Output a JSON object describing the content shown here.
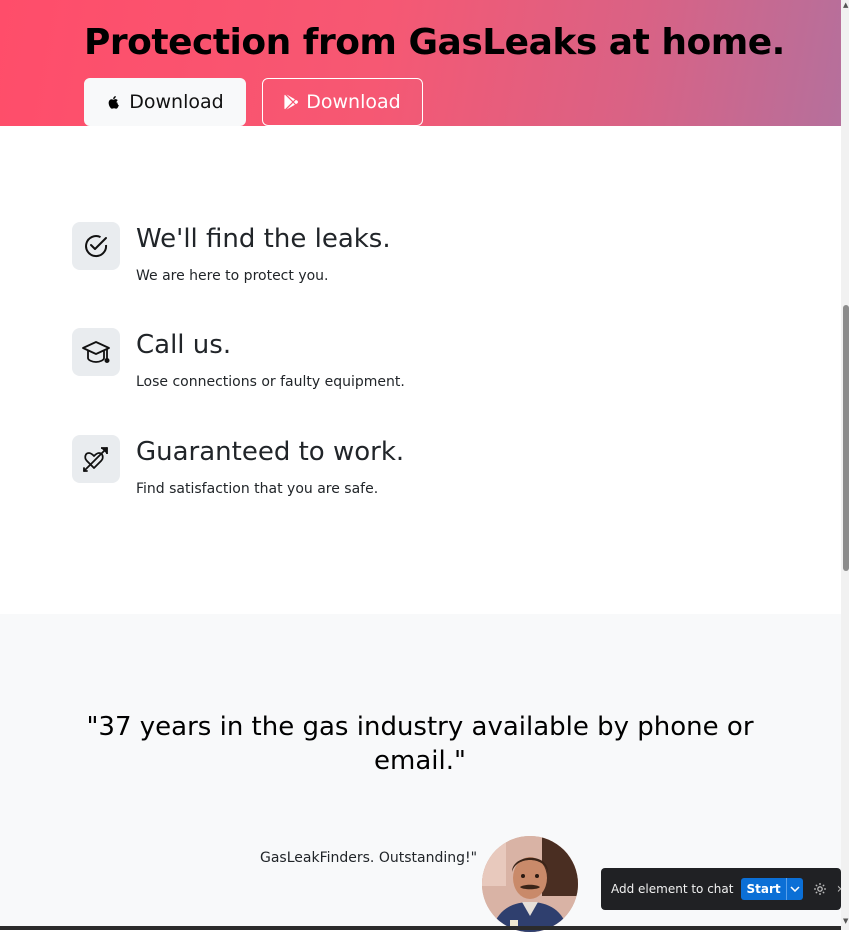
{
  "hero": {
    "title": "Protection from GasLeaks at home.",
    "apple_button_label": "Download",
    "play_button_label": "Download",
    "apple_icon": "apple-icon",
    "play_icon": "google-play-icon"
  },
  "features": [
    {
      "icon": "check-circle-icon",
      "title": "We'll find the leaks.",
      "text": "We are here to protect you."
    },
    {
      "icon": "graduation-cap-icon",
      "title": "Call us.",
      "text": "Lose connections or faulty equipment."
    },
    {
      "icon": "heart-arrow-icon",
      "title": "Guaranteed to work.",
      "text": "Find satisfaction that you are safe."
    }
  ],
  "testimonial": {
    "quote": "\"37 years in the gas industry available by phone or email.\"",
    "cite": "GasLeakFinders. Outstanding!\""
  },
  "chat_toolbar": {
    "label": "Add element to chat",
    "start_label": "Start"
  },
  "colors": {
    "hero_gradient_start": "#ff4d6a",
    "hero_gradient_end": "#b5709c",
    "testimonial_bg": "#f8f9fa",
    "chat_start_button": "#0b6fd6"
  }
}
